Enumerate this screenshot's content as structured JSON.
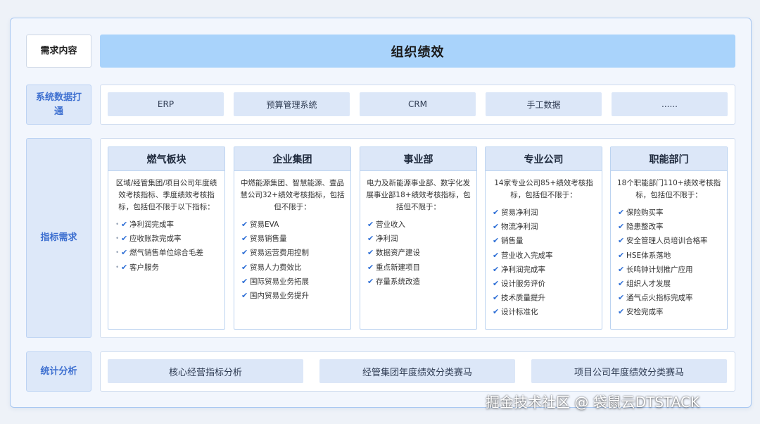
{
  "rows": {
    "demand_label": "需求内容",
    "system_label": "系统数据打通",
    "indicator_label": "指标需求",
    "stats_label": "统计分析"
  },
  "banner_title": "组织绩效",
  "systems": [
    "ERP",
    "预算管理系统",
    "CRM",
    "手工数据",
    "......"
  ],
  "cards": [
    {
      "title": "燃气板块",
      "desc": "区域/经管集团/项目公司年度绩效考核指标、季度绩效考核指标，包括但不限于以下指标：",
      "marker": "bullet",
      "items": [
        "净利润完成率",
        "应收账款完成率",
        "燃气销售单位综合毛差",
        "客户服务"
      ]
    },
    {
      "title": "企业集团",
      "desc": "中燃能源集团、智慧能源、壹品慧公司32+绩效考核指标，包括但不限于：",
      "marker": "check",
      "items": [
        "贸易EVA",
        "贸易销售量",
        "贸易运营费用控制",
        "贸易人力费效比",
        "国际贸易业务拓展",
        "国内贸易业务提升"
      ]
    },
    {
      "title": "事业部",
      "desc": "电力及新能源事业部、数字化发展事业部18+绩效考核指标，包括但不限于：",
      "marker": "check",
      "items": [
        "营业收入",
        "净利润",
        "数据资产建设",
        "重点新建项目",
        "存量系统改造"
      ]
    },
    {
      "title": "专业公司",
      "desc": "14家专业公司85+绩效考核指标，包括但不限于：",
      "marker": "check",
      "items": [
        "贸易净利润",
        "物流净利润",
        "销售量",
        "营业收入完成率",
        "净利润完成率",
        "设计服务评价",
        "技术质量提升",
        "设计标准化"
      ]
    },
    {
      "title": "职能部门",
      "desc": "18个职能部门110+绩效考核指标，包括但不限于：",
      "marker": "check",
      "items": [
        "保险购买率",
        "隐患整改率",
        "安全管理人员培训合格率",
        "HSE体系落地",
        "长鸣钟计划推广应用",
        "组织人才发展",
        "通气点火指标完成率",
        "安检完成率"
      ]
    }
  ],
  "stats": [
    "核心经营指标分析",
    "经管集团年度绩效分类赛马",
    "项目公司年度绩效分类赛马"
  ],
  "watermark": "掘金技术社区 @ 袋鼠云DTSTACK",
  "colors": {
    "accent": "#3d6fd0",
    "banner": "#a9d3fb",
    "box_fill": "#dce7f8",
    "check": "#2f6fd6"
  }
}
